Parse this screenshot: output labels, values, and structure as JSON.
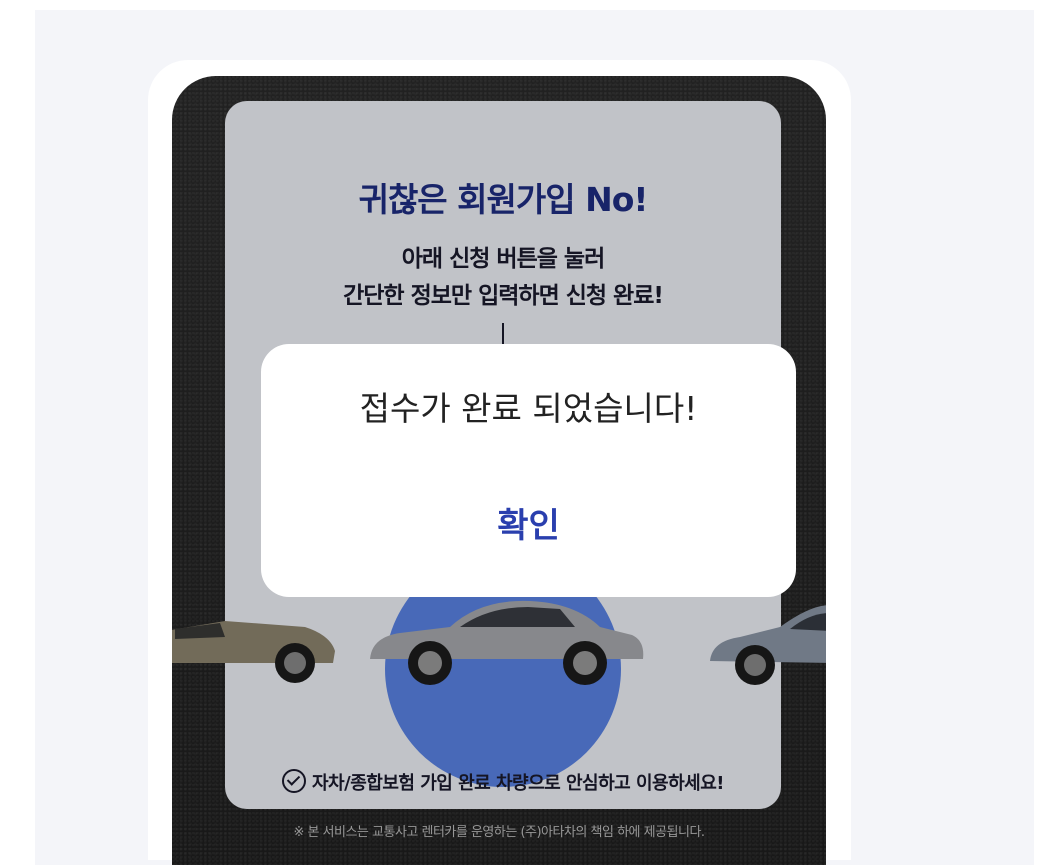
{
  "banner": {
    "headline": "귀찮은 회원가입 No!",
    "subline_1": "아래 신청 버튼을 눌러",
    "subline_2": "간단한 정보만 입력하면 신청 완료!",
    "footer_note": "자차/종합보험 가입 완료 차량으로 안심하고 이용하세요!",
    "legal_note": "※ 본 서비스는 교통사고 렌터카를 운영하는 (주)아타차의 책임 하에 제공됩니다."
  },
  "modal": {
    "message": "접수가 완료 되었습니다!",
    "confirm_label": "확인"
  },
  "colors": {
    "headline": "#1f2e84",
    "confirm": "#2a3fae",
    "circle": "#5a84e6"
  },
  "icons": [
    "check-circle-icon"
  ]
}
